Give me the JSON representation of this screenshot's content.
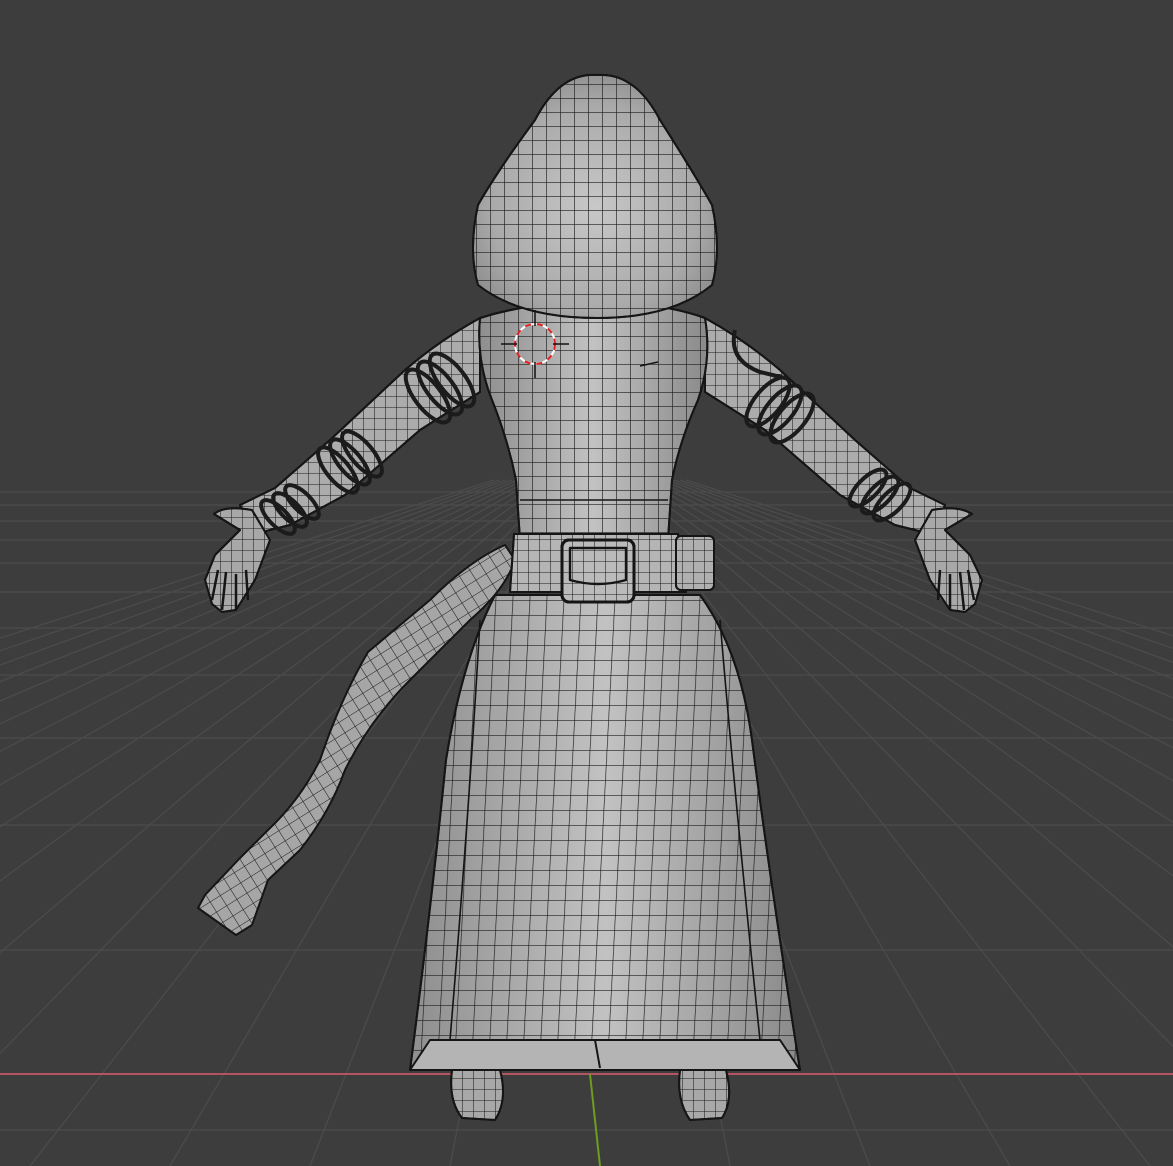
{
  "viewport": {
    "mode": "3d-viewport",
    "view": "front-orthographic",
    "shading": "solid-with-wireframe",
    "background_color": "#3d3d3d",
    "grid_color": "#4b4b4b",
    "x_axis_color": "#b35460",
    "z_axis_color": "#6f9b1f",
    "mesh_color": "#b8b8b8",
    "wire_color": "#1a1a1a",
    "cursor_color": "#e02020"
  },
  "scene": {
    "object": "hooded-character-mesh",
    "parts": [
      "hood",
      "torso",
      "left-arm",
      "right-arm",
      "left-hand",
      "right-hand",
      "belt",
      "belt-pouch",
      "side-pouch",
      "robe",
      "sword",
      "left-foot",
      "right-foot",
      "arm-bands"
    ],
    "cursor": "3d-cursor"
  }
}
